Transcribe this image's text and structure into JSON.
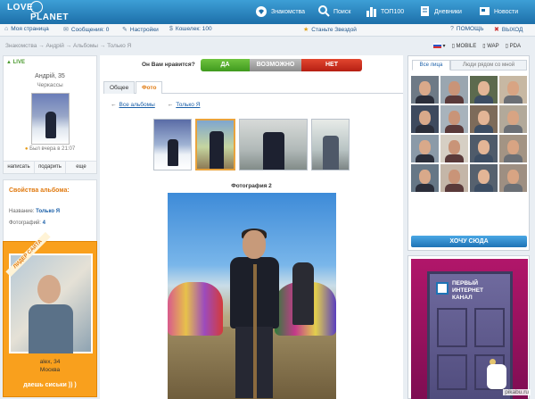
{
  "header": {
    "logo_line1": "LOVE",
    "logo_line2": "PLANET",
    "nav": [
      {
        "label": "Знакомства",
        "icon": "heart-chat-icon"
      },
      {
        "label": "Поиск",
        "icon": "search-icon"
      },
      {
        "label": "ТОП100",
        "icon": "bar-chart-icon"
      },
      {
        "label": "Дневники",
        "icon": "diary-icon"
      },
      {
        "label": "Новости",
        "icon": "news-icon"
      }
    ]
  },
  "subbar": {
    "my_page": "Моя страница",
    "messages": "Сообщения: 0",
    "settings": "Настройки",
    "wallet": "Кошелек: 100",
    "become_star": "Станьте Звездой",
    "help": "ПОМОЩЬ",
    "logout": "ВЫХОД"
  },
  "breadcrumb": "Знакомства → Андрій → Альбомы → Только Я",
  "langs": {
    "ru": "",
    "mobile": "MOBILE",
    "wap": "WAP",
    "pda": "PDA"
  },
  "profile": {
    "live": "LIVE",
    "name": "Андрій, 35",
    "city": "Черкассы",
    "seen": "Был вчера в 21:07",
    "actions": [
      "написать",
      "подарить",
      "еще"
    ]
  },
  "album_props": {
    "title": "Свойства альбома:",
    "name_label": "Название:",
    "name_value": "Только Я",
    "photos_label": "Фотографий:",
    "photos_value": "4"
  },
  "leader": {
    "ribbon": "ЛИДЕР САЙТА",
    "name": "alex, 34",
    "city": "Москва",
    "give": "даешь сиськи )) )"
  },
  "vote": {
    "question": "Он Вам нравится?",
    "yes": "ДА",
    "maybe": "ВОЗМОЖНО",
    "no": "НЕТ"
  },
  "tabs": [
    "Общее",
    "Фото"
  ],
  "active_tab": "Фото",
  "backlinks": {
    "all_albums": "Все альбомы",
    "only_me": "Только Я"
  },
  "photo": {
    "title": "Фотография 2",
    "selected_index": 2,
    "count": 4
  },
  "right": {
    "tab_all": "Все лица",
    "tab_near": "Люди рядом со мной",
    "want_button": "ХОЧУ СЮДА"
  },
  "ad": {
    "line1": "ПЕРВЫЙ",
    "line2": "ИНТЕРНЕТ",
    "line3": "КАНАЛ"
  },
  "watermark": "pikabu.ru",
  "colors": {
    "accent": "#1d6fa9",
    "orange": "#f9a01d",
    "yes": "#3f9a1e",
    "no": "#b51f13"
  }
}
